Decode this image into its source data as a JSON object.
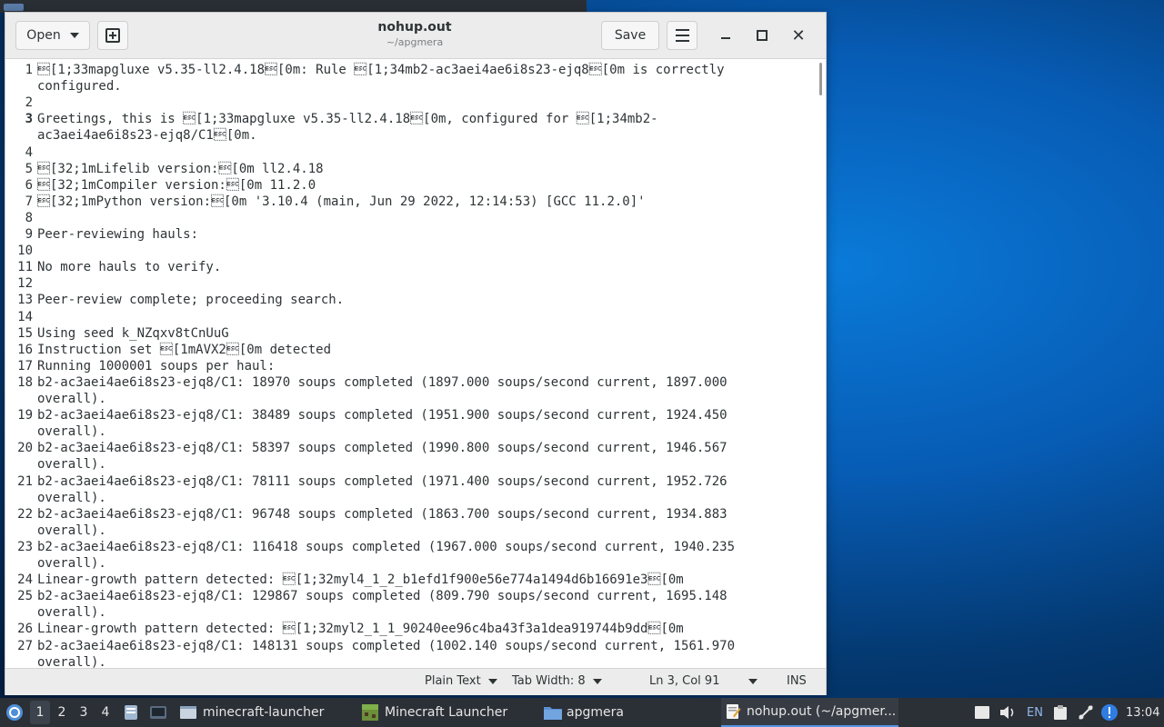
{
  "window": {
    "title": "nohup.out",
    "subtitle": "~/apgmera",
    "open_label": "Open",
    "save_label": "Save"
  },
  "editor": {
    "current_line": "3",
    "lines": [
      {
        "num": "1",
        "text": "\u001b[1;33mapgluxe v5.35-ll2.4.18\u001b[0m: Rule \u001b[1;34mb2-ac3aei4ae6i8s23-ejq8\u001b[0m is correctly"
      },
      {
        "num": "",
        "text": "configured."
      },
      {
        "num": "2",
        "text": ""
      },
      {
        "num": "3",
        "text": "Greetings, this is \u001b[1;33mapgluxe v5.35-ll2.4.18\u001b[0m, configured for \u001b[1;34mb2-"
      },
      {
        "num": "",
        "text": "ac3aei4ae6i8s23-ejq8/C1\u001b[0m."
      },
      {
        "num": "4",
        "text": ""
      },
      {
        "num": "5",
        "text": "\u001b[32;1mLifelib version:\u001b[0m ll2.4.18"
      },
      {
        "num": "6",
        "text": "\u001b[32;1mCompiler version:\u001b[0m 11.2.0"
      },
      {
        "num": "7",
        "text": "\u001b[32;1mPython version:\u001b[0m '3.10.4 (main, Jun 29 2022, 12:14:53) [GCC 11.2.0]'"
      },
      {
        "num": "8",
        "text": ""
      },
      {
        "num": "9",
        "text": "Peer-reviewing hauls:"
      },
      {
        "num": "10",
        "text": ""
      },
      {
        "num": "11",
        "text": "No more hauls to verify."
      },
      {
        "num": "12",
        "text": ""
      },
      {
        "num": "13",
        "text": "Peer-review complete; proceeding search."
      },
      {
        "num": "14",
        "text": ""
      },
      {
        "num": "15",
        "text": "Using seed k_NZqxv8tCnUuG"
      },
      {
        "num": "16",
        "text": "Instruction set \u001b[1mAVX2\u001b[0m detected"
      },
      {
        "num": "17",
        "text": "Running 1000001 soups per haul:"
      },
      {
        "num": "18",
        "text": "b2-ac3aei4ae6i8s23-ejq8/C1: 18970 soups completed (1897.000 soups/second current, 1897.000"
      },
      {
        "num": "",
        "text": "overall)."
      },
      {
        "num": "19",
        "text": "b2-ac3aei4ae6i8s23-ejq8/C1: 38489 soups completed (1951.900 soups/second current, 1924.450"
      },
      {
        "num": "",
        "text": "overall)."
      },
      {
        "num": "20",
        "text": "b2-ac3aei4ae6i8s23-ejq8/C1: 58397 soups completed (1990.800 soups/second current, 1946.567"
      },
      {
        "num": "",
        "text": "overall)."
      },
      {
        "num": "21",
        "text": "b2-ac3aei4ae6i8s23-ejq8/C1: 78111 soups completed (1971.400 soups/second current, 1952.726"
      },
      {
        "num": "",
        "text": "overall)."
      },
      {
        "num": "22",
        "text": "b2-ac3aei4ae6i8s23-ejq8/C1: 96748 soups completed (1863.700 soups/second current, 1934.883"
      },
      {
        "num": "",
        "text": "overall)."
      },
      {
        "num": "23",
        "text": "b2-ac3aei4ae6i8s23-ejq8/C1: 116418 soups completed (1967.000 soups/second current, 1940.235"
      },
      {
        "num": "",
        "text": "overall)."
      },
      {
        "num": "24",
        "text": "Linear-growth pattern detected: \u001b[1;32myl4_1_2_b1efd1f900e56e774a1494d6b16691e3\u001b[0m"
      },
      {
        "num": "25",
        "text": "b2-ac3aei4ae6i8s23-ejq8/C1: 129867 soups completed (809.790 soups/second current, 1695.148"
      },
      {
        "num": "",
        "text": "overall)."
      },
      {
        "num": "26",
        "text": "Linear-growth pattern detected: \u001b[1;32myl2_1_1_90240ee96c4ba43f3a1dea919744b9dd\u001b[0m"
      },
      {
        "num": "27",
        "text": "b2-ac3aei4ae6i8s23-ejq8/C1: 148131 soups completed (1002.140 soups/second current, 1561.970"
      },
      {
        "num": "",
        "text": "overall)."
      }
    ]
  },
  "statusbar": {
    "language": "Plain Text",
    "tab_width": "Tab Width: 8",
    "position": "Ln 3, Col 91",
    "mode": "INS"
  },
  "taskbar": {
    "workspaces": [
      "1",
      "2",
      "3",
      "4"
    ],
    "active_workspace": "1",
    "tasks": [
      {
        "label": "minecraft-launcher",
        "icon": "window-icon"
      },
      {
        "label": "Minecraft Launcher",
        "icon": "minecraft-icon"
      },
      {
        "label": "apgmera",
        "icon": "folder-icon"
      },
      {
        "label": "nohup.out (~/apgmer...",
        "icon": "text-editor-icon"
      }
    ],
    "keyboard_layout": "EN",
    "clock": "13:04"
  },
  "colors": {
    "accent": "#5294e2",
    "taskbar_bg": "#2b2f36",
    "headerbar_bg": "#ececec"
  }
}
